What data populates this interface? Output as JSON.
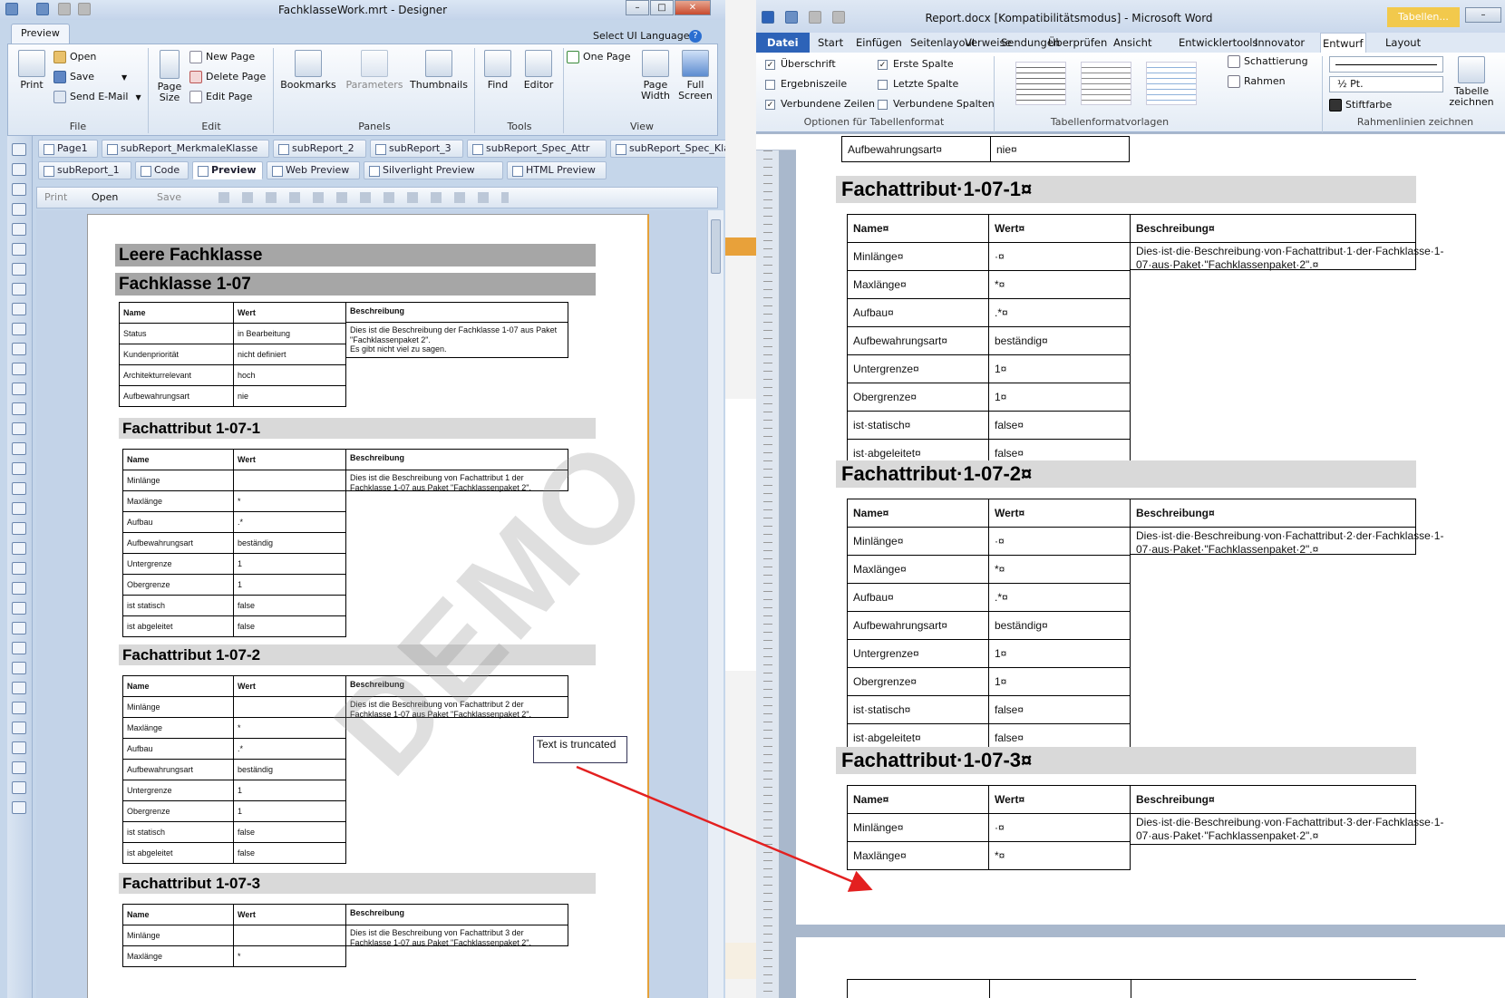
{
  "designer": {
    "title": "FachklasseWork.mrt - Designer",
    "ribbon_tab": "Preview",
    "select_language": "Select UI Language",
    "file_group": {
      "label": "File",
      "print": "Print",
      "open": "Open",
      "save": "Save",
      "send_email": "Send E-Mail"
    },
    "edit_group": {
      "label": "Edit",
      "page_size": "Page Size",
      "new_page": "New Page",
      "delete_page": "Delete Page",
      "edit_page": "Edit Page"
    },
    "panels_group": {
      "label": "Panels",
      "bookmarks": "Bookmarks",
      "parameters": "Parameters",
      "thumbnails": "Thumbnails"
    },
    "tools_group": {
      "label": "Tools",
      "find": "Find",
      "editor": "Editor"
    },
    "view_group": {
      "label": "View",
      "one_page": "One Page",
      "page_width": "Page Width",
      "full_screen": "Full Screen"
    },
    "page_tabs_row1": [
      "Page1",
      "subReport_MerkmaleKlasse",
      "subReport_2",
      "subReport_3",
      "subReport_Spec_Attr",
      "subReport_Spec_Klasse"
    ],
    "page_tabs_row2": [
      "subReport_1",
      "Code",
      "Preview",
      "Web Preview",
      "Silverlight Preview",
      "HTML Preview"
    ],
    "toolbar": {
      "print": "Print",
      "open": "Open",
      "save": "Save"
    },
    "watermark": "DEMO",
    "truncated_box": "Text is truncated",
    "report": {
      "h1a": "Leere Fachklasse",
      "h1b": "Fachklasse 1-07",
      "col_name": "Name",
      "col_wert": "Wert",
      "col_desc": "Beschreibung",
      "class_rows": [
        {
          "name": "Status",
          "value": "in Bearbeitung"
        },
        {
          "name": "Kundenpriorität",
          "value": "nicht definiert"
        },
        {
          "name": "Architekturrelevant",
          "value": "hoch"
        },
        {
          "name": "Aufbewahrungsart",
          "value": "nie"
        }
      ],
      "class_desc_1": "Dies ist die Beschreibung der Fachklasse 1-07 aus Paket \"Fachklassenpaket 2\".",
      "class_desc_2": "Es gibt nicht viel zu sagen.",
      "attr1": {
        "title": "Fachattribut 1-07-1",
        "desc": "Dies ist die Beschreibung von Fachattribut 1 der Fachklasse 1-07 aus Paket \"Fachklassenpaket 2\"."
      },
      "attr2": {
        "title": "Fachattribut 1-07-2",
        "desc": "Dies ist die Beschreibung von Fachattribut 2 der Fachklasse 1-07 aus Paket \"Fachklassenpaket 2\"."
      },
      "attr3": {
        "title": "Fachattribut 1-07-3",
        "desc": "Dies ist die Beschreibung von Fachattribut 3 der Fachklasse 1-07 aus Paket \"Fachklassenpaket 2\"."
      },
      "attr_rows": [
        {
          "name": "Minlänge",
          "value": ""
        },
        {
          "name": "Maxlänge",
          "value": "*"
        },
        {
          "name": "Aufbau",
          "value": ".*"
        },
        {
          "name": "Aufbewahrungsart",
          "value": "beständig"
        },
        {
          "name": "Untergrenze",
          "value": "1"
        },
        {
          "name": "Obergrenze",
          "value": "1"
        },
        {
          "name": "ist statisch",
          "value": "false"
        },
        {
          "name": "ist abgeleitet",
          "value": "false"
        }
      ]
    }
  },
  "word": {
    "title": "Report.docx [Kompatibilitätsmodus] - Microsoft Word",
    "context_tab": "Tabellen...",
    "tabs": [
      "Datei",
      "Start",
      "Einfügen",
      "Seitenlayout",
      "Verweise",
      "Sendungen",
      "Überprüfen",
      "Ansicht",
      "Entwicklertools",
      "Innovator",
      "Entwurf",
      "Layout"
    ],
    "options": {
      "ueberschrift": "Überschrift",
      "ergebniszeile": "Ergebniszeile",
      "verbundene_zeilen": "Verbundene Zeilen",
      "erste_spalte": "Erste Spalte",
      "letzte_spalte": "Letzte Spalte",
      "verbundene_spalten": "Verbundene Spalten",
      "group_label": "Optionen für Tabellenformat"
    },
    "styles_label": "Tabellenformatvorlagen",
    "schattierung": "Schattierung",
    "rahmen": "Rahmen",
    "pen_size": "½ Pt.",
    "stiftfarbe": "Stiftfarbe",
    "tabelle_zeichnen": "Tabelle zeichnen",
    "rahmenlinien_label": "Rahmenlinien zeichnen",
    "prev_row": {
      "name": "Aufbewahrungsart¤",
      "value": "nie¤"
    },
    "col_name": "Name¤",
    "col_wert": "Wert¤",
    "col_desc": "Beschreibung¤",
    "attr1": {
      "title": "Fachattribut·1-07-1¤",
      "desc": "Dies·ist·die·Beschreibung·von·Fachattribut·1·der·Fachklasse·1-07·aus·Paket·\"Fachklassenpaket·2\".¤"
    },
    "attr2": {
      "title": "Fachattribut·1-07-2¤",
      "desc": "Dies·ist·die·Beschreibung·von·Fachattribut·2·der·Fachklasse·1-07·aus·Paket·\"Fachklassenpaket·2\".¤"
    },
    "attr3": {
      "title": "Fachattribut·1-07-3¤",
      "desc": "Dies·ist·die·Beschreibung·von·Fachattribut·3·der·Fachklasse·1-07·aus·Paket·\"Fachklassenpaket·2\".¤"
    },
    "attr_rows": [
      {
        "name": "Minlänge¤",
        "value": "·¤"
      },
      {
        "name": "Maxlänge¤",
        "value": "*¤"
      },
      {
        "name": "Aufbau¤",
        "value": ".*¤"
      },
      {
        "name": "Aufbewahrungsart¤",
        "value": "beständig¤"
      },
      {
        "name": "Untergrenze¤",
        "value": "1¤"
      },
      {
        "name": "Obergrenze¤",
        "value": "1¤"
      },
      {
        "name": "ist·statisch¤",
        "value": "false¤"
      },
      {
        "name": "ist·abgeleitet¤",
        "value": "false¤"
      }
    ],
    "attr3_rows": [
      {
        "name": "Minlänge¤",
        "value": "·¤"
      },
      {
        "name": "Maxlänge¤",
        "value": "*¤"
      }
    ]
  },
  "colors": {
    "arrow": "#e32020",
    "report_h1_bg": "#a6a6a6",
    "report_h2_bg": "#d9d9d9",
    "word_file_tab": "#2d63b8"
  }
}
